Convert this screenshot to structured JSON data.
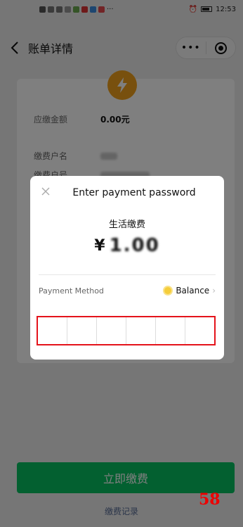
{
  "status_bar": {
    "time": "12:53",
    "more": "···"
  },
  "nav": {
    "title": "账单详情",
    "more": "•••"
  },
  "bill": {
    "amount_label": "应缴金额",
    "amount_value": "0.00元",
    "account_name_label": "缴费户名",
    "account_no_label": "缴费户号"
  },
  "bottom": {
    "pay_button": "立即缴费",
    "history_link": "缴费记录",
    "page_number": "58"
  },
  "dialog": {
    "title": "Enter payment password",
    "merchant": "生活缴费",
    "currency": "¥",
    "amount": "1.00",
    "method_label": "Payment Method",
    "method_value": "Balance",
    "password_digits": 6
  },
  "colors": {
    "accent_green": "#07c160",
    "password_box_border": "#e4131b",
    "page_number": "#e00000",
    "bill_icon": "#f0a01c"
  }
}
